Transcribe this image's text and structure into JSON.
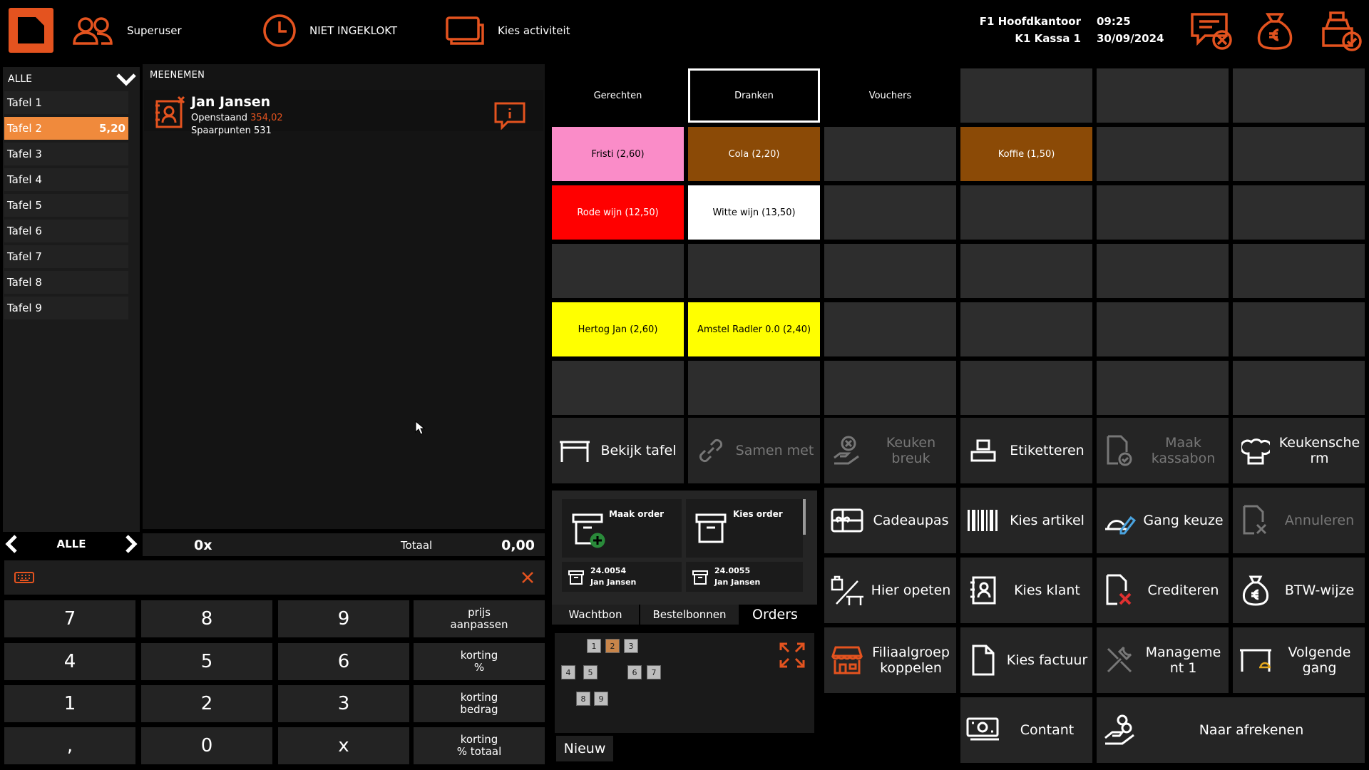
{
  "header": {
    "user": "Superuser",
    "clock_status": "NIET INGEKLOKT",
    "activity": "Kies activiteit",
    "branch": "F1 Hoofdkantoor",
    "register": "K1 Kassa 1",
    "time": "09:25",
    "date": "30/09/2024",
    "icons": [
      "user-group-icon",
      "clock-icon",
      "activity-cards-icon",
      "message-cancel-icon",
      "money-bag-icon",
      "register-check-icon"
    ],
    "accent": "#e4531f"
  },
  "tables": {
    "filter": "ALLE",
    "items": [
      {
        "label": "Tafel 1",
        "amount": ""
      },
      {
        "label": "Tafel 2",
        "amount": "5,20"
      },
      {
        "label": "Tafel 3",
        "amount": ""
      },
      {
        "label": "Tafel 4",
        "amount": ""
      },
      {
        "label": "Tafel 5",
        "amount": ""
      },
      {
        "label": "Tafel 6",
        "amount": ""
      },
      {
        "label": "Tafel 7",
        "amount": ""
      },
      {
        "label": "Tafel 8",
        "amount": ""
      },
      {
        "label": "Tafel 9",
        "amount": ""
      }
    ],
    "nav_label": "ALLE"
  },
  "order": {
    "type": "MEENEMEN",
    "customer_name": "Jan Jansen",
    "balance_label": "Openstaand",
    "balance_value": "354,02",
    "points_label": "Spaarpunten",
    "points_value": "531",
    "count": "0x",
    "total_label": "Totaal",
    "total_value": "0,00"
  },
  "keypad": {
    "keys": [
      "7",
      "8",
      "9",
      "4",
      "5",
      "6",
      "1",
      "2",
      "3",
      ",",
      "0",
      "x"
    ],
    "fn": [
      "prijs\naanpassen",
      "korting\n%",
      "korting\nbedrag",
      "korting\n% totaal"
    ]
  },
  "categories": [
    "Gerechten",
    "Dranken",
    "Vouchers"
  ],
  "products": [
    {
      "label": "Fristi (2,60)",
      "color": "#fa8cc8",
      "text": "#000"
    },
    {
      "label": "Cola (2,20)",
      "color": "#8b4a06",
      "text": "#fff"
    },
    {
      "label": "Koffie (1,50)",
      "color": "#8b4a06",
      "text": "#fff"
    },
    {
      "label": "Rode wijn (12,50)",
      "color": "#ff0000",
      "text": "#fff"
    },
    {
      "label": "Witte wijn (13,50)",
      "color": "#ffffff",
      "text": "#000"
    },
    {
      "label": "Hertog Jan (2,60)",
      "color": "#ffff00",
      "text": "#000"
    },
    {
      "label": "Amstel Radler 0.0 (2,40)",
      "color": "#ffff00",
      "text": "#000"
    }
  ],
  "actions": {
    "bekijk_tafel": "Bekijk tafel",
    "samen_met": "Samen met",
    "keuken_breuk": "Keuken\nbreuk",
    "etiketteren": "Etiketteren",
    "maak_kassabon": "Maak\nkassabon",
    "keukenscherm": "Keukensche\nrm",
    "cadeaupas": "Cadeaupas",
    "kies_artikel": "Kies artikel",
    "gang_keuze": "Gang keuze",
    "annuleren": "Annuleren",
    "hier_opeten": "Hier opeten",
    "kies_klant": "Kies klant",
    "crediteren": "Crediteren",
    "btw_wijze": "BTW-wijze",
    "filiaalgroep": "Filiaalgroep\nkoppelen",
    "kies_factuur": "Kies factuur",
    "management": "Manageme\nnt 1",
    "volgende_gang": "Volgende\ngang",
    "contant": "Contant",
    "naar_afrekenen": "Naar afrekenen"
  },
  "orders_panel": {
    "maak_order": "Maak order",
    "kies_order": "Kies order",
    "order1_no": "24.0054",
    "order1_name": "Jan Jansen",
    "order2_no": "24.0055",
    "order2_name": "Jan Jansen",
    "tabs": [
      "Wachtbon",
      "Bestelbonnen",
      "Orders"
    ],
    "tiles": [
      "1",
      "2",
      "3",
      "4",
      "5",
      "6",
      "7",
      "8",
      "9"
    ],
    "nieuw": "Nieuw"
  }
}
